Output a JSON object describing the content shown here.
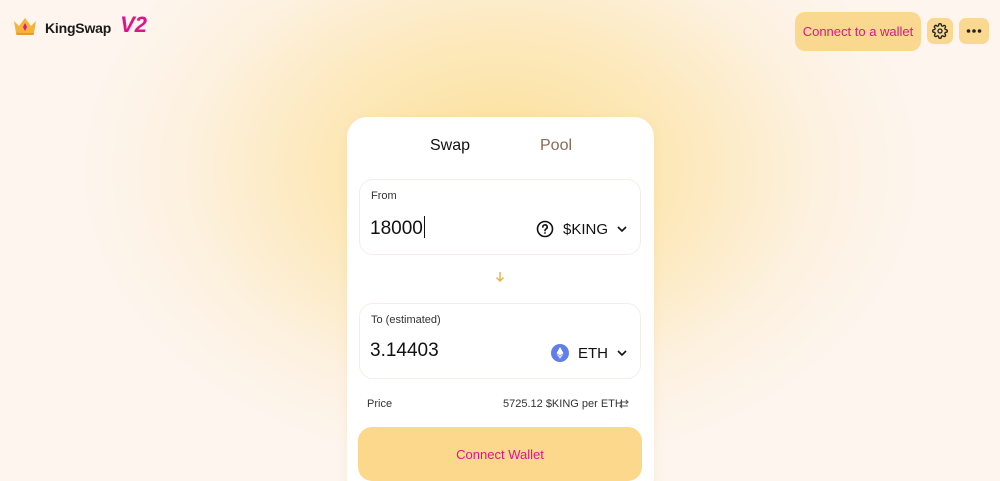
{
  "header": {
    "brand": "KingSwap",
    "version": "V2",
    "connect_label": "Connect to a wallet"
  },
  "tabs": [
    {
      "label": "Swap",
      "active": true
    },
    {
      "label": "Pool",
      "active": false
    }
  ],
  "from": {
    "label": "From",
    "amount": "18000",
    "token": "$KING",
    "token_icon": "question-circle-icon"
  },
  "to": {
    "label": "To (estimated)",
    "amount": "3.14403",
    "token": "ETH",
    "token_icon": "eth-icon"
  },
  "price": {
    "label": "Price",
    "value": "5725.12 $KING per ETH"
  },
  "connect_wallet_label": "Connect Wallet",
  "colors": {
    "accent_pink": "#e0148a",
    "button_yellow": "#fbd890",
    "arrow_gold": "#e6b04a",
    "eth_blue": "#627eea"
  }
}
